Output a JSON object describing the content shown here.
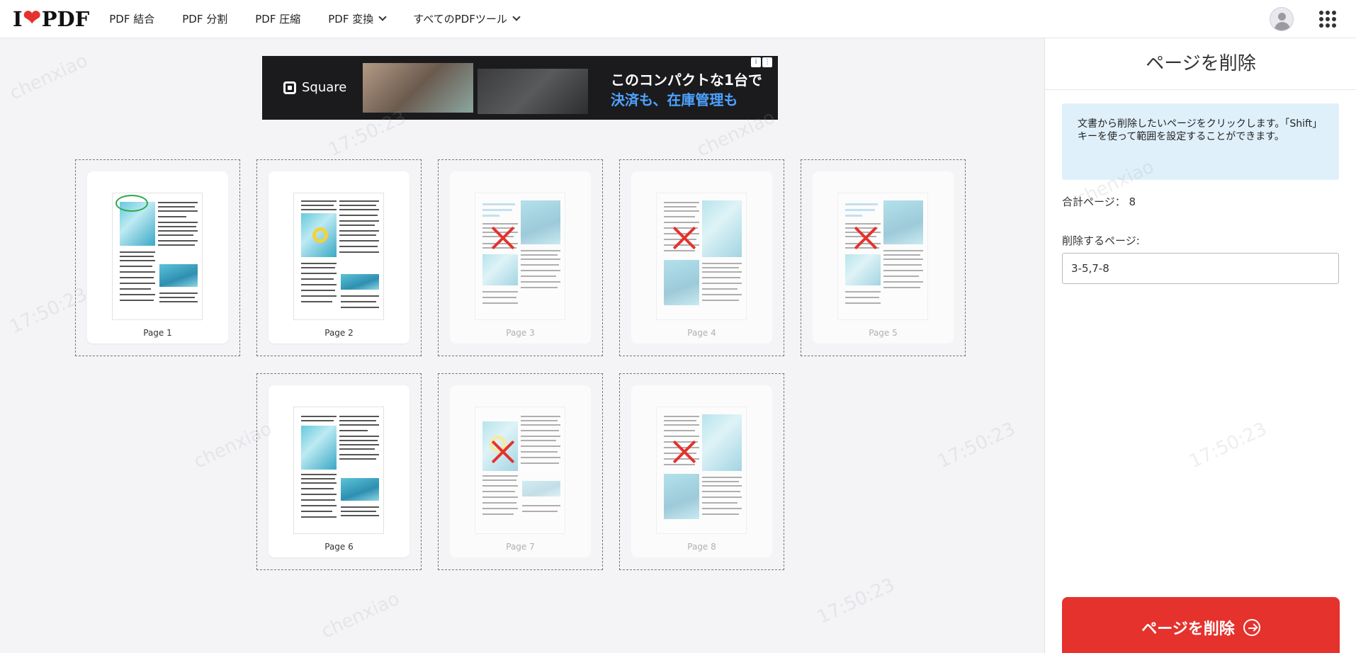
{
  "header": {
    "logo_left": "I",
    "logo_right": "PDF",
    "nav": [
      {
        "label": "PDF 結合",
        "dropdown": false
      },
      {
        "label": "PDF 分割",
        "dropdown": false
      },
      {
        "label": "PDF 圧縮",
        "dropdown": false
      },
      {
        "label": "PDF 変換",
        "dropdown": true
      },
      {
        "label": "すべてのPDFツール",
        "dropdown": true
      }
    ]
  },
  "ad": {
    "brand": "Square",
    "line1": "このコンパクトな1台で",
    "line2": "決済も、在庫管理も",
    "info_icons": [
      "i",
      "⋮"
    ]
  },
  "pages": [
    {
      "label": "Page 1",
      "deleted": false
    },
    {
      "label": "Page 2",
      "deleted": false
    },
    {
      "label": "Page 3",
      "deleted": true
    },
    {
      "label": "Page 4",
      "deleted": true
    },
    {
      "label": "Page 5",
      "deleted": true
    },
    {
      "label": "Page 6",
      "deleted": false
    },
    {
      "label": "Page 7",
      "deleted": true
    },
    {
      "label": "Page 8",
      "deleted": true
    }
  ],
  "sidebar": {
    "title": "ページを削除",
    "info": "文書から削除したいページをクリックします。「Shift」キーを使って範囲を設定することができます。",
    "total_label": "合計ページ：",
    "total_value": "8",
    "delete_label": "削除するページ:",
    "delete_value": "3-5,7-8",
    "button_label": "ページを削除"
  },
  "watermark": {
    "user": "chenxiao",
    "time": "17:50:23"
  },
  "colors": {
    "brand_red": "#e5322d",
    "info_blue": "#dff0fb"
  }
}
